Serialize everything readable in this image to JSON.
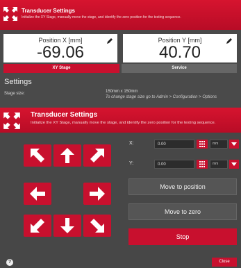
{
  "header_top": {
    "title": "Transducer Settings",
    "subtitle": "Initialize the XY Stage, manually move the stage, and identify the zero position for the testing sequence."
  },
  "position_x": {
    "label": "Position X [mm]",
    "value": "-69.06"
  },
  "position_y": {
    "label": "Position Y [mm]",
    "value": "40.70"
  },
  "tabs": [
    {
      "label": "XY Stage"
    },
    {
      "label": "Service"
    }
  ],
  "settings": {
    "title": "Settings",
    "stage_size_label": "Stage size:",
    "stage_size_value": "150mm x 150mm",
    "stage_size_note": "To change stage size go to Admin > Configuration > Options"
  },
  "header_main": {
    "title": "Transducer Settings",
    "subtitle": "Initialize the XY Stage, manually move the stage, and identify the zero position for the testing sequence."
  },
  "x_field": {
    "label": "X:",
    "value": "0.00",
    "unit": "mm"
  },
  "y_field": {
    "label": "Y:",
    "value": "0.00",
    "unit": "mm"
  },
  "buttons": {
    "move_to_position": "Move to position",
    "move_to_zero": "Move to zero",
    "stop": "Stop",
    "close": "Close",
    "help": "?"
  },
  "colors": {
    "accent": "#c8102e",
    "panel": "#474747"
  },
  "icons": {
    "arrows": [
      "arrow-up-left-icon",
      "arrow-up-icon",
      "arrow-up-right-icon",
      "arrow-left-icon",
      "arrow-right-icon",
      "arrow-down-left-icon",
      "arrow-down-icon",
      "arrow-down-right-icon"
    ]
  }
}
